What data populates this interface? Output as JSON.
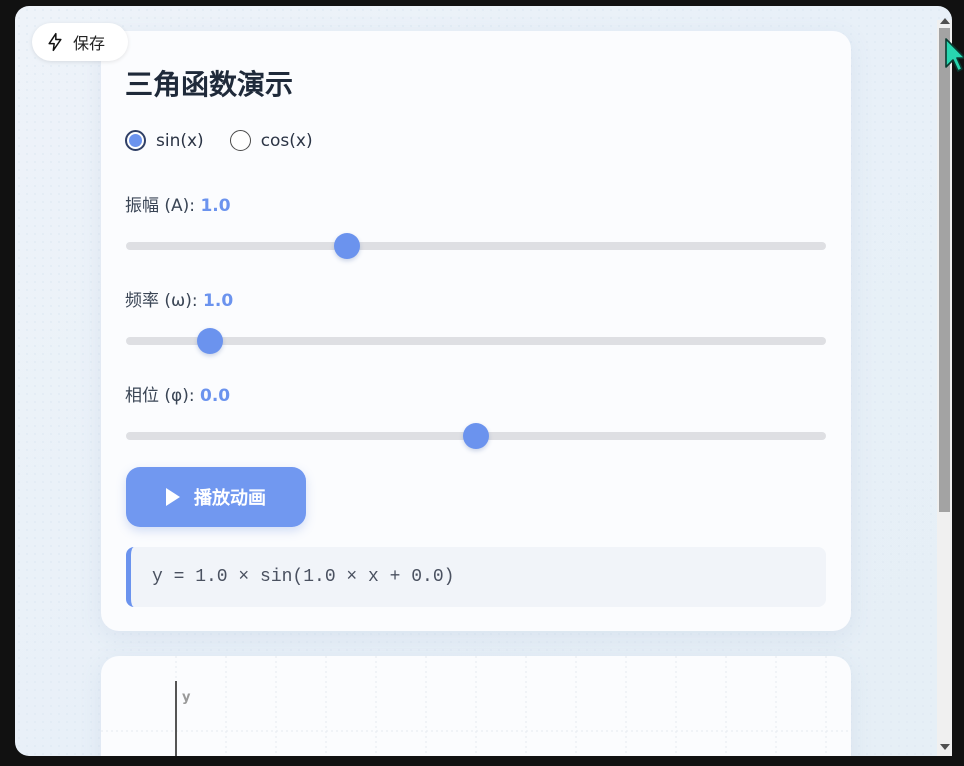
{
  "toolbar": {
    "save_label": "保存",
    "save_icon": "sparkle-icon"
  },
  "controls": {
    "title": "三角函数演示",
    "function_options": [
      {
        "label": "sin(x)",
        "checked": true
      },
      {
        "label": "cos(x)",
        "checked": false
      }
    ],
    "amplitude": {
      "label": "振幅 (A): ",
      "value": "1.0",
      "slider_fraction": 0.315
    },
    "frequency": {
      "label": "频率 (ω): ",
      "value": "1.0",
      "slider_fraction": 0.12
    },
    "phase": {
      "label": "相位 (φ): ",
      "value": "0.0",
      "slider_fraction": 0.5
    },
    "play_label": "播放动画",
    "formula": "y = 1.0 × sin(1.0 × x + 0.0)"
  },
  "chart": {
    "y_axis_label": "y"
  },
  "colors": {
    "accent": "#6b93ee",
    "title": "#1f2a3a",
    "track": "#dedfe3"
  }
}
